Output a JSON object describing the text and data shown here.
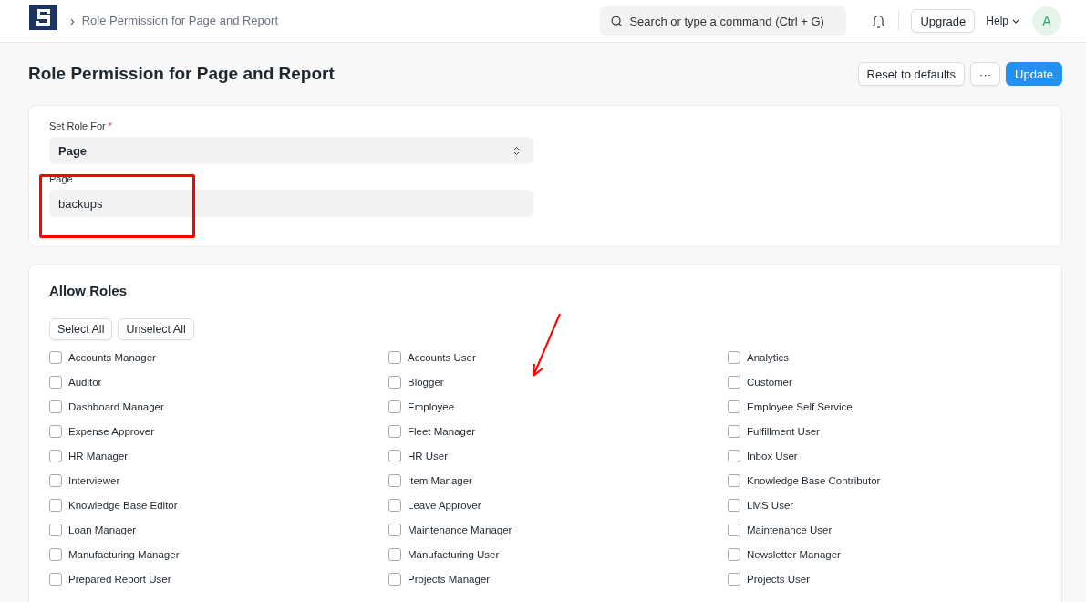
{
  "navbar": {
    "breadcrumb_separator": "›",
    "breadcrumb": "Role Permission for Page and Report",
    "search": {
      "placeholder": "Search or type a command (Ctrl + G)"
    },
    "upgrade": "Upgrade",
    "help": "Help",
    "avatar": "A"
  },
  "page_header": {
    "title": "Role Permission for Page and Report",
    "buttons": [
      {
        "label": "Reset to defaults",
        "kind": "default"
      },
      {
        "label": "···",
        "kind": "default"
      },
      {
        "label": "Update",
        "kind": "primary"
      }
    ]
  },
  "form": {
    "set_role_for": {
      "label": "Set Role For",
      "required_mark": "*",
      "value": "Page"
    },
    "page": {
      "label": "Page",
      "value": "backups"
    }
  },
  "allow_roles": {
    "title": "Allow Roles",
    "buttons": [
      "Select All",
      "Unselect All"
    ],
    "roles": [
      {
        "label": "Accounts Manager",
        "checked": false
      },
      {
        "label": "Accounts User",
        "checked": false
      },
      {
        "label": "Analytics",
        "checked": false
      },
      {
        "label": "Auditor",
        "checked": false
      },
      {
        "label": "Blogger",
        "checked": false
      },
      {
        "label": "Customer",
        "checked": false
      },
      {
        "label": "Dashboard Manager",
        "checked": false
      },
      {
        "label": "Employee",
        "checked": false
      },
      {
        "label": "Employee Self Service",
        "checked": false
      },
      {
        "label": "Expense Approver",
        "checked": false
      },
      {
        "label": "Fleet Manager",
        "checked": false
      },
      {
        "label": "Fulfillment User",
        "checked": false
      },
      {
        "label": "HR Manager",
        "checked": false
      },
      {
        "label": "HR User",
        "checked": false
      },
      {
        "label": "Inbox User",
        "checked": false
      },
      {
        "label": "Interviewer",
        "checked": false
      },
      {
        "label": "Item Manager",
        "checked": false
      },
      {
        "label": "Knowledge Base Contributor",
        "checked": false
      },
      {
        "label": "Knowledge Base Editor",
        "checked": false
      },
      {
        "label": "Leave Approver",
        "checked": false
      },
      {
        "label": "LMS User",
        "checked": false
      },
      {
        "label": "Loan Manager",
        "checked": false
      },
      {
        "label": "Maintenance Manager",
        "checked": false
      },
      {
        "label": "Maintenance User",
        "checked": false
      },
      {
        "label": "Manufacturing Manager",
        "checked": false
      },
      {
        "label": "Manufacturing User",
        "checked": false
      },
      {
        "label": "Newsletter Manager",
        "checked": false
      },
      {
        "label": "Prepared Report User",
        "checked": false
      },
      {
        "label": "Projects Manager",
        "checked": false
      },
      {
        "label": "Projects User",
        "checked": false
      }
    ]
  }
}
